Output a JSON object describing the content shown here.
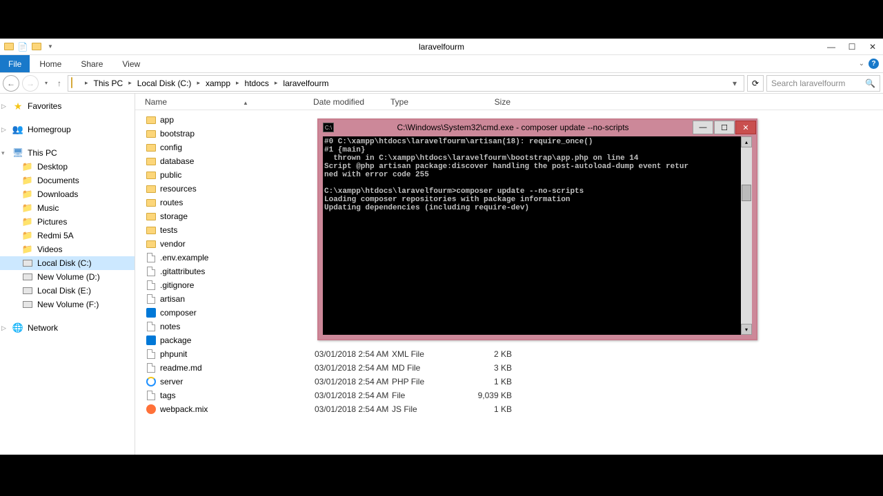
{
  "window": {
    "title": "laravelfourm"
  },
  "ribbon": {
    "file": "File",
    "tabs": [
      "Home",
      "Share",
      "View"
    ]
  },
  "breadcrumb": {
    "segments": [
      "This PC",
      "Local Disk (C:)",
      "xampp",
      "htdocs",
      "laravelfourm"
    ]
  },
  "search": {
    "placeholder": "Search laravelfourm"
  },
  "sidebar": {
    "favorites": {
      "label": "Favorites"
    },
    "homegroup": {
      "label": "Homegroup"
    },
    "thispc": {
      "label": "This PC",
      "children": [
        {
          "label": "Desktop"
        },
        {
          "label": "Documents"
        },
        {
          "label": "Downloads"
        },
        {
          "label": "Music"
        },
        {
          "label": "Pictures"
        },
        {
          "label": "Redmi 5A"
        },
        {
          "label": "Videos"
        },
        {
          "label": "Local Disk (C:)",
          "selected": true,
          "icon": "drive"
        },
        {
          "label": "New Volume (D:)",
          "icon": "drive"
        },
        {
          "label": "Local Disk (E:)",
          "icon": "drive"
        },
        {
          "label": "New Volume (F:)",
          "icon": "drive"
        }
      ]
    },
    "network": {
      "label": "Network"
    }
  },
  "columns": {
    "name": "Name",
    "date": "Date modified",
    "type": "Type",
    "size": "Size"
  },
  "files": [
    {
      "name": "app",
      "icon": "folder"
    },
    {
      "name": "bootstrap",
      "icon": "folder"
    },
    {
      "name": "config",
      "icon": "folder"
    },
    {
      "name": "database",
      "icon": "folder"
    },
    {
      "name": "public",
      "icon": "folder"
    },
    {
      "name": "resources",
      "icon": "folder"
    },
    {
      "name": "routes",
      "icon": "folder"
    },
    {
      "name": "storage",
      "icon": "folder"
    },
    {
      "name": "tests",
      "icon": "folder"
    },
    {
      "name": "vendor",
      "icon": "folder"
    },
    {
      "name": ".env.example",
      "icon": "file"
    },
    {
      "name": ".gitattributes",
      "icon": "file"
    },
    {
      "name": ".gitignore",
      "icon": "file"
    },
    {
      "name": "artisan",
      "icon": "file"
    },
    {
      "name": "composer",
      "icon": "vs"
    },
    {
      "name": "notes",
      "icon": "file"
    },
    {
      "name": "package",
      "icon": "vs"
    },
    {
      "name": "phpunit",
      "icon": "file",
      "date": "03/01/2018 2:54 AM",
      "type": "XML File",
      "size": "2 KB"
    },
    {
      "name": "readme.md",
      "icon": "file",
      "date": "03/01/2018 2:54 AM",
      "type": "MD File",
      "size": "3 KB"
    },
    {
      "name": "server",
      "icon": "ie",
      "date": "03/01/2018 2:54 AM",
      "type": "PHP File",
      "size": "1 KB"
    },
    {
      "name": "tags",
      "icon": "file",
      "date": "03/01/2018 2:54 AM",
      "type": "File",
      "size": "9,039 KB"
    },
    {
      "name": "webpack.mix",
      "icon": "ff",
      "date": "03/01/2018 2:54 AM",
      "type": "JS File",
      "size": "1 KB"
    }
  ],
  "cmd": {
    "title": "C:\\Windows\\System32\\cmd.exe - composer  update --no-scripts",
    "lines": [
      "#0 C:\\xampp\\htdocs\\laravelfourm\\artisan(18): require_once()",
      "#1 {main}",
      "  thrown in C:\\xampp\\htdocs\\laravelfourm\\bootstrap\\app.php on line 14",
      "Script @php artisan package:discover handling the post-autoload-dump event retur",
      "ned with error code 255",
      "",
      "C:\\xampp\\htdocs\\laravelfourm>composer update --no-scripts",
      "Loading composer repositories with package information",
      "Updating dependencies (including require-dev)"
    ]
  }
}
